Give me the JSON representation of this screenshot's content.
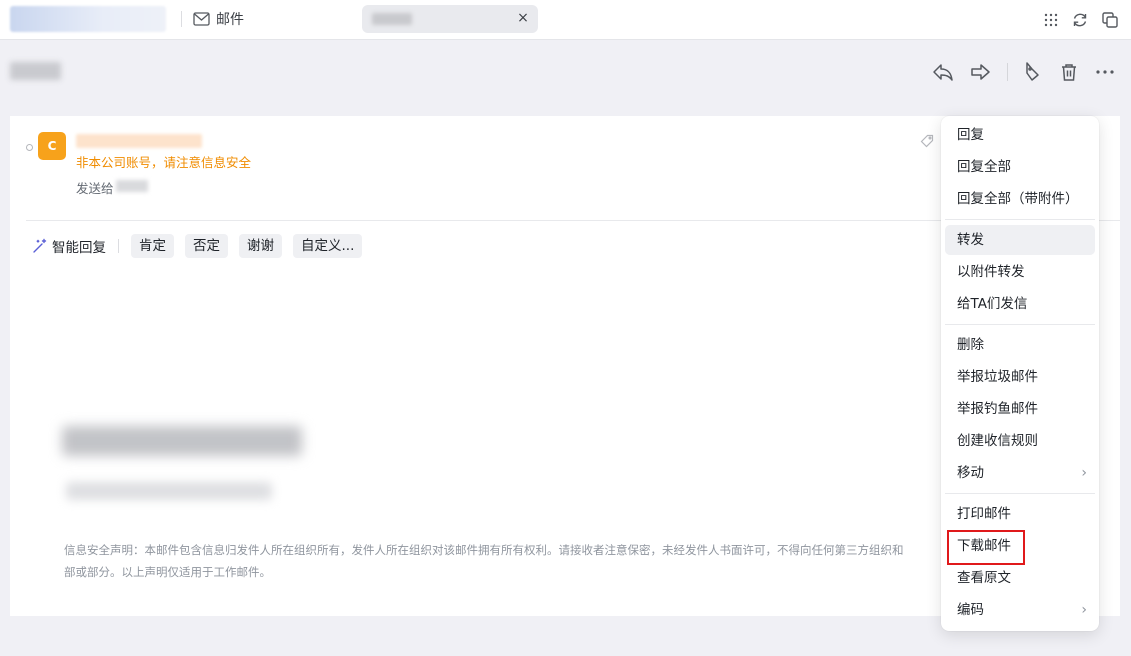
{
  "topbar": {
    "mail_tab_label": "邮件",
    "doc_tab_close": "×",
    "icons": [
      "apps-grid-icon",
      "refresh-icon",
      "open-window-icon"
    ]
  },
  "toolbar": {
    "icons": [
      "reply-icon",
      "forward-icon",
      "tag-icon",
      "delete-icon",
      "more-icon"
    ]
  },
  "mail": {
    "avatar_initial": "C",
    "warning": "非本公司账号，请注意信息安全",
    "to_label": "发送给",
    "smart_reply": {
      "label": "智能回复",
      "chips": [
        "肯定",
        "否定",
        "谢谢",
        "自定义..."
      ]
    },
    "disclaimer": {
      "line1": "信息安全声明：本邮件包含信息归发件人所在组织所有，发件人所在组织对该邮件拥有所有权利。请接收者注意保密，未经发件人书面许可，不得向任何第三方组织和",
      "line2": "部或部分。以上声明仅适用于工作邮件。"
    }
  },
  "menu": {
    "items": [
      {
        "label": "回复"
      },
      {
        "label": "回复全部"
      },
      {
        "label": "回复全部（带附件）"
      },
      {
        "label": "转发",
        "hovered": true
      },
      {
        "label": "以附件转发"
      },
      {
        "label": "给TA们发信"
      },
      {
        "label": "删除"
      },
      {
        "label": "举报垃圾邮件"
      },
      {
        "label": "举报钓鱼邮件"
      },
      {
        "label": "创建收信规则"
      },
      {
        "label": "移动",
        "submenu": true
      },
      {
        "label": "打印邮件"
      },
      {
        "label": "下载邮件",
        "highlighted": true
      },
      {
        "label": "查看原文"
      },
      {
        "label": "编码",
        "submenu": true
      }
    ],
    "chevron": "›"
  },
  "colors": {
    "accent_warning": "#f08c00",
    "avatar_bg": "#f7a21b",
    "highlight": "#e0191b"
  }
}
